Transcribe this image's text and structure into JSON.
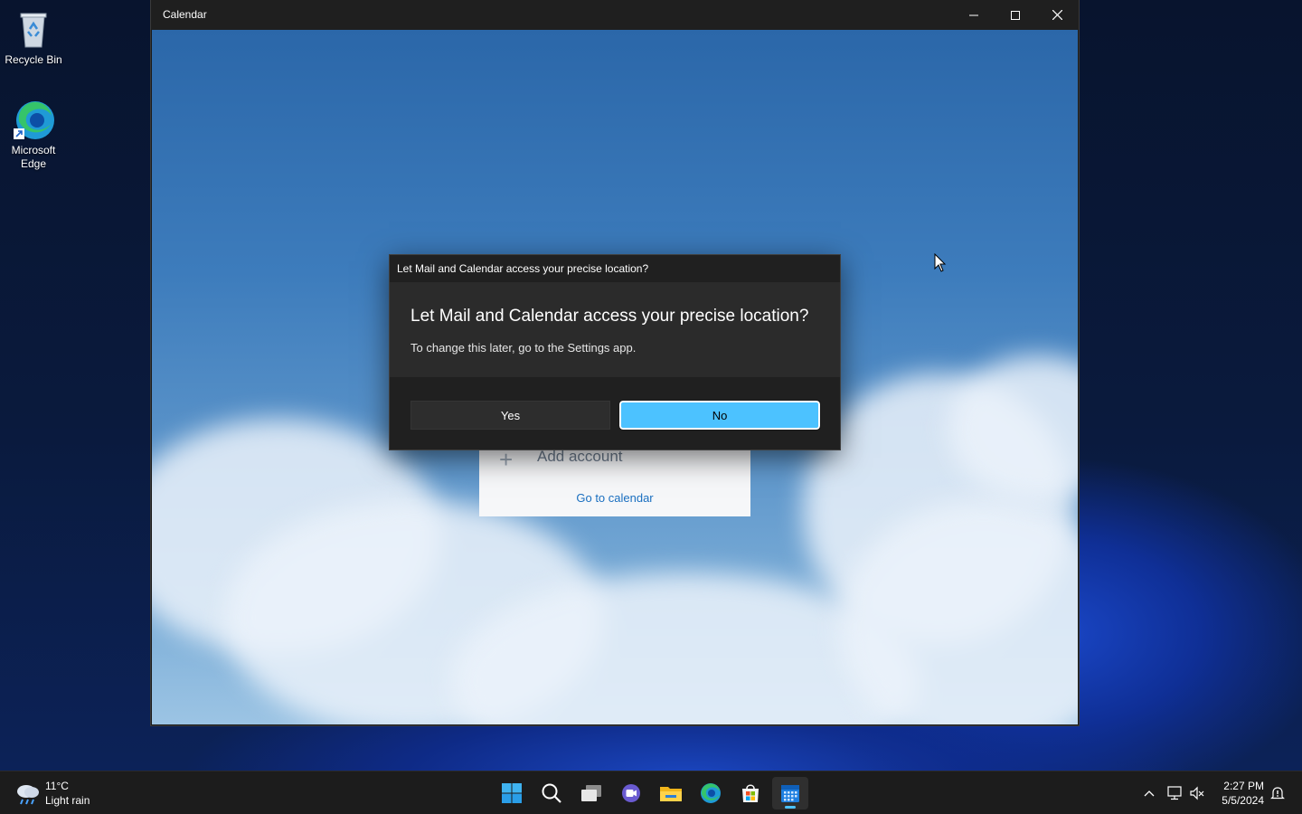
{
  "desktop": {
    "icons": [
      {
        "label": "Recycle Bin"
      },
      {
        "label": "Microsoft Edge"
      }
    ]
  },
  "window": {
    "title": "Calendar",
    "controls": {
      "minimize": "minimize",
      "maximize": "maximize",
      "close": "close"
    }
  },
  "app": {
    "add_account_label": "Add account",
    "go_to_calendar_label": "Go to calendar"
  },
  "dialog": {
    "title_bar": "Let Mail and Calendar access your precise location?",
    "heading": "Let Mail and Calendar access your precise location?",
    "body": "To change this later, go to the Settings app.",
    "yes_label": "Yes",
    "no_label": "No"
  },
  "taskbar": {
    "weather": {
      "temperature": "11°C",
      "condition": "Light rain"
    },
    "apps": [
      "start-icon",
      "search-icon",
      "task-view-icon",
      "chat-icon",
      "file-explorer-icon",
      "edge-icon",
      "store-icon",
      "calendar-icon"
    ],
    "active_app": "calendar-icon",
    "clock": {
      "time": "2:27 PM",
      "date": "5/5/2024"
    }
  },
  "colors": {
    "accent": "#4cc2ff",
    "link": "#1a6fc0",
    "dialog_bg": "#2b2b2b"
  }
}
